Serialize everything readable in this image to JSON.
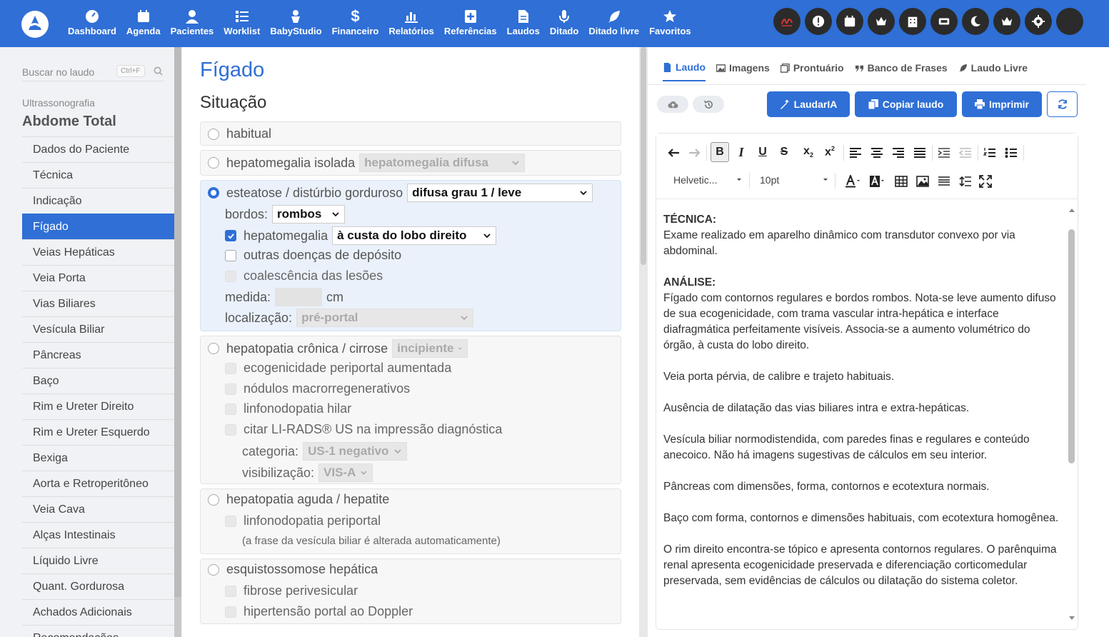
{
  "nav": {
    "items": [
      {
        "label": "Dashboard",
        "icon": "dashboard-icon"
      },
      {
        "label": "Agenda",
        "icon": "calendar-icon"
      },
      {
        "label": "Pacientes",
        "icon": "user-icon"
      },
      {
        "label": "Worklist",
        "icon": "list-icon"
      },
      {
        "label": "BabyStudio",
        "icon": "baby-icon"
      },
      {
        "label": "Financeiro",
        "icon": "dollar-icon"
      },
      {
        "label": "Relatórios",
        "icon": "chart-icon"
      },
      {
        "label": "Referências",
        "icon": "book-plus-icon"
      },
      {
        "label": "Laudos",
        "icon": "file-icon"
      },
      {
        "label": "Ditado",
        "icon": "microphone-icon"
      },
      {
        "label": "Ditado livre",
        "icon": "feather-icon"
      },
      {
        "label": "Favoritos",
        "icon": "star-icon"
      }
    ]
  },
  "sidebar": {
    "search_placeholder": "Buscar no laudo",
    "shortcut": "Ctrl+F",
    "exam_category": "Ultrassonografia",
    "exam_title": "Abdome Total",
    "items": [
      "Dados do Paciente",
      "Técnica",
      "Indicação",
      "Fígado",
      "Veias Hepáticas",
      "Veia Porta",
      "Vias Biliares",
      "Vesícula Biliar",
      "Pâncreas",
      "Baço",
      "Rim e Ureter Direito",
      "Rim e Ureter Esquerdo",
      "Bexiga",
      "Aorta e Retroperitôneo",
      "Veia Cava",
      "Alças Intestinais",
      "Líquido Livre",
      "Quant. Gordurosa",
      "Achados Adicionais",
      "Recomendações"
    ],
    "active_index": 3
  },
  "form": {
    "section_title": "Fígado",
    "subsection_title": "Situação",
    "habitual": "habitual",
    "hep_isolada": "hepatomegalia isolada",
    "hep_isolada_select": "hepatomegalia difusa",
    "esteatose": "esteatose / distúrbio gorduroso",
    "esteatose_select": "difusa grau 1 / leve",
    "bordos_label": "bordos:",
    "bordos_select": "rombos",
    "hepatomegalia": "hepatomegalia",
    "hepatomegalia_select": "à custa do lobo direito",
    "outras": "outras doenças de depósito",
    "coalescencia": "coalescência das lesões",
    "medida_label": "medida:",
    "medida_unit": "cm",
    "localizacao_label": "localização:",
    "localizacao_select": "pré-portal",
    "cronica": "hepatopatia crônica / cirrose",
    "cronica_select": "incipiente",
    "eco_periportal": "ecogenicidade periportal aumentada",
    "nodulos": "nódulos macrorregenerativos",
    "linfo_hilar": "linfonodopatia hilar",
    "lirads": "citar LI-RADS® US na impressão diagnóstica",
    "categoria_label": "categoria:",
    "categoria_select": "US-1 negativo",
    "visibilizacao_label": "visibilização:",
    "visibilizacao_select": "VIS-A",
    "aguda": "hepatopatia aguda / hepatite",
    "linfo_periportal": "linfonodopatia periportal",
    "aguda_note": "(a frase da vesícula biliar é alterada automaticamente)",
    "esquisto": "esquistossomose hepática",
    "fibrose": "fibrose perivesicular",
    "hipertensao": "hipertensão portal ao Doppler"
  },
  "right": {
    "tabs": [
      "Laudo",
      "Imagens",
      "Prontuário",
      "Banco de Frases",
      "Laudo Livre"
    ],
    "btn_ia": "LaudarIA",
    "btn_copy": "Copiar laudo",
    "btn_print": "Imprimir",
    "font_name": "Helvetic...",
    "font_size": "10pt",
    "doc": {
      "h1": "TÉCNICA:",
      "p1": "Exame realizado em aparelho dinâmico com transdutor convexo por via abdominal.",
      "h2": "ANÁLISE:",
      "p2": "Fígado com contornos regulares e bordos rombos. Nota-se leve aumento difuso de sua ecogenicidade, com trama vascular intra-hepática e interface diafragmática perfeitamente visíveis. Associa-se a aumento volumétrico do órgão, à custa do lobo direito.",
      "p3": "Veia porta pérvia, de calibre e trajeto habituais.",
      "p4": "Ausência de dilatação das vias biliares intra e extra-hepáticas.",
      "p5": "Vesícula biliar normodistendida, com paredes finas e regulares e conteúdo anecoico. Não há imagens sugestivas de cálculos em seu interior.",
      "p6": "Pâncreas com dimensões, forma, contornos e ecotextura normais.",
      "p7": "Baço com forma, contornos e dimensões habituais, com ecotextura homogênea.",
      "p8": "O rim direito encontra-se tópico e apresenta contornos regulares. O parênquima renal apresenta ecogenicidade preservada e diferenciação corticomedular preservada, sem evidências de cálculos ou dilatação do sistema coletor."
    }
  }
}
